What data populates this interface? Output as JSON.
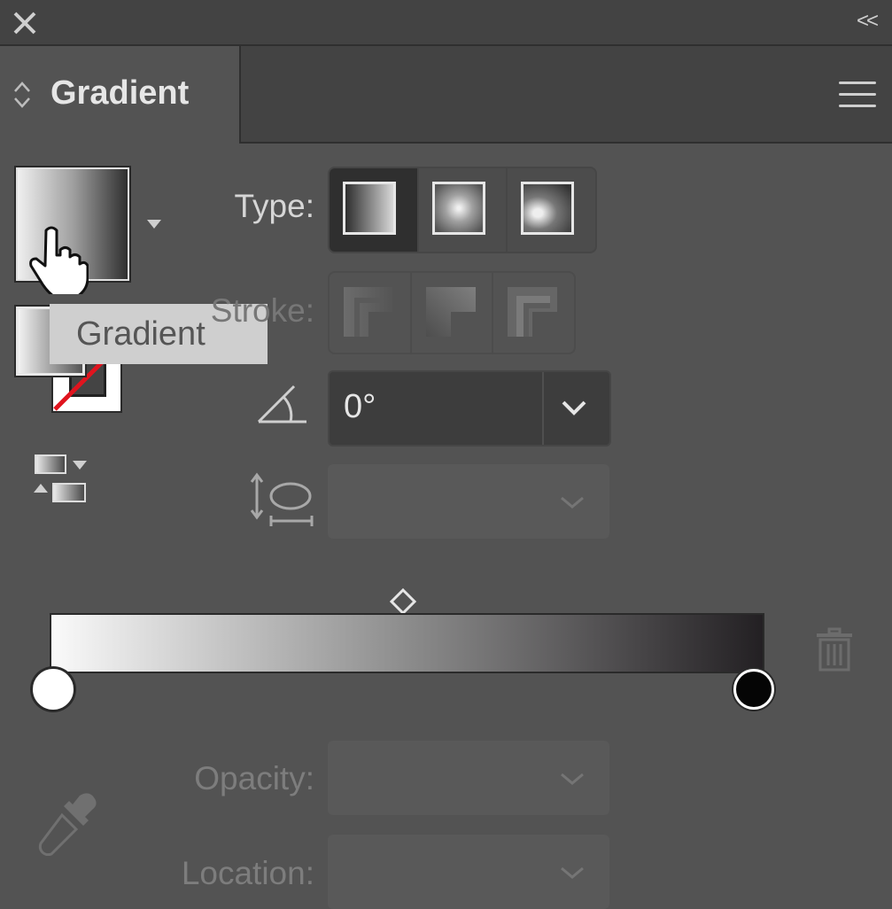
{
  "window": {
    "close_icon": "close-icon",
    "collapse_label": "<<"
  },
  "tab": {
    "title": "Gradient",
    "arrows_icon": "up-down-arrows-icon",
    "menu_icon": "hamburger-menu-icon"
  },
  "swatch": {
    "tooltip": "Gradient"
  },
  "type": {
    "label": "Type:",
    "options": [
      "Linear gradient",
      "Radial gradient",
      "Freeform gradient"
    ],
    "selected": "Linear gradient"
  },
  "stroke": {
    "label": "Stroke:",
    "options": [
      "Apply gradient within stroke",
      "Apply gradient along stroke",
      "Apply gradient across stroke"
    ]
  },
  "angle": {
    "value": "0°"
  },
  "aspect": {
    "value": ""
  },
  "gradient_bar": {
    "stops": [
      {
        "color": "#ffffff",
        "location": 0
      },
      {
        "color": "#000000",
        "location": 100
      }
    ]
  },
  "opacity": {
    "label": "Opacity:",
    "value": ""
  },
  "location": {
    "label": "Location:",
    "value": ""
  }
}
